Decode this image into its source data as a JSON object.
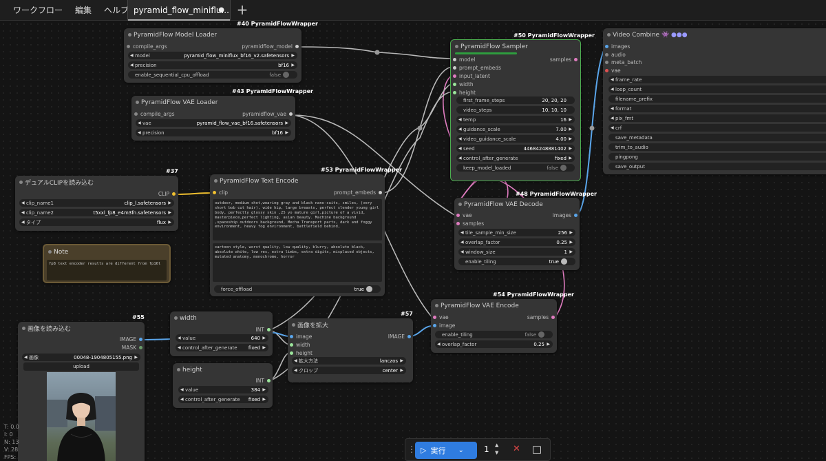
{
  "menu": {
    "workflow": "ワークフロー",
    "edit": "編集",
    "help": "ヘルプ"
  },
  "tab": {
    "title": "pyramid_flow_miniflu...",
    "modified_dot": "●",
    "new_tab": "+"
  },
  "colors": {
    "run_button": "#2f7ce0",
    "sampler_border": "#4caf50",
    "wire_pink": "#e07cc0",
    "wire_blue": "#5aa5ea",
    "wire_yellow": "#f0c030",
    "wire_gray": "#b8b8b8"
  },
  "nodes": {
    "model_loader": {
      "badge": "#40 PyramidFlowWrapper",
      "title": "PyramidFlow Model Loader",
      "in_compile": "compile_args",
      "out_model": "pyramidflow_model",
      "w_model_label": "model",
      "w_model_value": "pyramid_flow_miniflux_bf16_v2.safetensors",
      "w_precision_label": "precision",
      "w_precision_value": "bf16",
      "w_offload_label": "enable_sequential_cpu_offload",
      "w_offload_value": "false"
    },
    "vae_loader": {
      "badge": "#43 PyramidFlowWrapper",
      "title": "PyramidFlow VAE Loader",
      "in_compile": "compile_args",
      "out_vae": "pyramidflow_vae",
      "w_vae_label": "vae",
      "w_vae_value": "pyramid_flow_vae_bf16.safetensors",
      "w_precision_label": "precision",
      "w_precision_value": "bf16"
    },
    "dual_clip": {
      "badge": "#37",
      "title": "デュアルCLIPを読み込む",
      "out_clip": "CLIP",
      "w1_label": "clip_name1",
      "w1_value": "clip_l.safetensors",
      "w2_label": "clip_name2",
      "w2_value": "t5xxl_fp8_e4m3fn.safetensors",
      "w3_label": "タイプ",
      "w3_value": "flux"
    },
    "note": {
      "title": "Note",
      "text": "fp8 text encoder results are different from fp16l"
    },
    "text_encode": {
      "badge": "#53 PyramidFlowWrapper",
      "title": "PyramidFlow Text Encode",
      "in_clip": "clip",
      "out_embeds": "prompt_embeds",
      "positive": "outdoor, medium shot,wearing gray and black nano-suits, smiles, (very short bob cut hair), wide hip, large breasts, perfect slender young girl body, perfectly glossy skin ,25 yo mature girl,picture of a vivid, masterpiece,perfect lighting, asian beauty. Machine background ,spaceship outdoors background, Mecha Transport parts, dark and foggy environment, heavy fog environment, battlefield behind,",
      "negative": "cartoon style, worst quality, low quality, blurry, absolute black, absolute white, low res, extra limbs, extra digits, misplaced objects, mutated anatomy, monochrome, horror",
      "w_offload_label": "force_offload",
      "w_offload_value": "true"
    },
    "sampler": {
      "badge": "#50 PyramidFlowWrapper",
      "title": "PyramidFlow Sampler",
      "in_model": "model",
      "in_embeds": "prompt_embeds",
      "in_latent": "input_latent",
      "in_width": "width",
      "in_height": "height",
      "out_samples": "samples",
      "widgets": [
        {
          "label": "first_frame_steps",
          "value": "20, 20, 20"
        },
        {
          "label": "video_steps",
          "value": "10, 10, 10"
        },
        {
          "label": "temp",
          "value": "16"
        },
        {
          "label": "guidance_scale",
          "value": "7.00"
        },
        {
          "label": "video_guidance_scale",
          "value": "4.00"
        },
        {
          "label": "seed",
          "value": "44684248881402"
        },
        {
          "label": "control_after_generate",
          "value": "fixed"
        },
        {
          "label": "keep_model_loaded",
          "value": "false"
        }
      ]
    },
    "video_combine": {
      "title": "Video Combine",
      "title_icons": "👾 ●●●",
      "inputs": [
        "images",
        "audio",
        "meta_batch",
        "vae"
      ],
      "widgets": [
        "frame_rate",
        "loop_count",
        "filename_prefix",
        "format",
        "pix_fmt",
        "crf",
        "save_metadata",
        "trim_to_audio",
        "pingpong",
        "save_output"
      ]
    },
    "vae_decode": {
      "badge": "#48 PyramidFlowWrapper",
      "title": "PyramidFlow VAE Decode",
      "in_vae": "vae",
      "in_samples": "samples",
      "out_images": "images",
      "widgets": [
        {
          "label": "tile_sample_min_size",
          "value": "256"
        },
        {
          "label": "overlap_factor",
          "value": "0.25"
        },
        {
          "label": "window_size",
          "value": "1"
        },
        {
          "label": "enable_tiling",
          "value": "true"
        }
      ]
    },
    "vae_encode": {
      "badge": "#54 PyramidFlowWrapper",
      "title": "PyramidFlow VAE Encode",
      "in_vae": "vae",
      "in_image": "image",
      "out_samples": "samples",
      "w_tiling_label": "enable_tiling",
      "w_tiling_value": "false",
      "w_overlap_label": "overlap_factor",
      "w_overlap_value": "0.25"
    },
    "load_image": {
      "badge": "#55",
      "title": "画像を読み込む",
      "out_image": "IMAGE",
      "out_mask": "MASK",
      "w_image_label": "画像",
      "w_image_value": "00048-1904805155.png",
      "upload": "upload"
    },
    "width_node": {
      "title": "width",
      "out_int": "INT",
      "w_value_label": "value",
      "w_value_value": "640",
      "w_ctrl_label": "control_after_generate",
      "w_ctrl_value": "fixed"
    },
    "height_node": {
      "title": "height",
      "out_int": "INT",
      "w_value_label": "value",
      "w_value_value": "384",
      "w_ctrl_label": "control_after_generate",
      "w_ctrl_value": "fixed"
    },
    "upscale": {
      "badge": "#57",
      "title": "画像を拡大",
      "in_image": "image",
      "in_width": "width",
      "in_height": "height",
      "out_image": "IMAGE",
      "w_method_label": "拡大方法",
      "w_method_value": "lanczos",
      "w_crop_label": "クロップ",
      "w_crop_value": "center"
    }
  },
  "runbar": {
    "handle": "⋮",
    "run_label": "実行",
    "batch_count": "1",
    "cancel_icon": "✕"
  },
  "stats": [
    "T: 0.0",
    "I: 0",
    "N: 13",
    "V: 28",
    "FPS:"
  ]
}
